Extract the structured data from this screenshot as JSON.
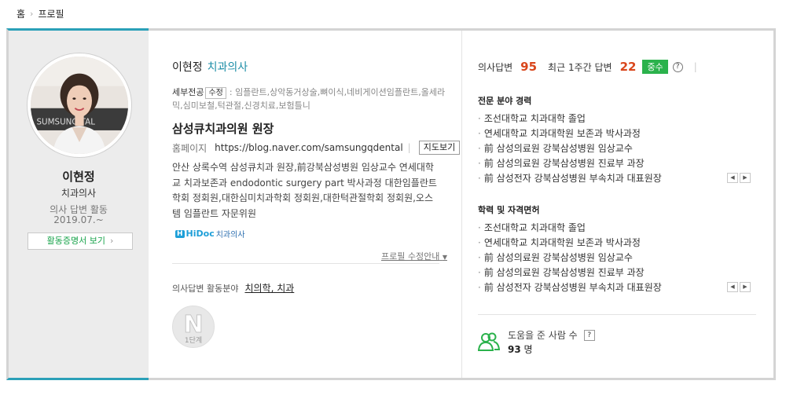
{
  "breadcrumb": {
    "home": "홈",
    "current": "프로필"
  },
  "profile": {
    "name": "이현정",
    "role": "치과의사",
    "activity_label": "의사 답변 활동",
    "activity_since": "2019.07.~",
    "cert_button": "활동증명서 보기",
    "avatar_text": "SUMSUNG      TAL"
  },
  "detail": {
    "name": "이현정",
    "role": "치과의사",
    "specialty_label": "세부전공",
    "specialty_edit": "수정",
    "specialty_text": ": 임플란트,상악동거상술,뼈이식,네비게이션임플란트,올세라믹,심미보철,턱관절,신경치료,보험틀니",
    "clinic": "삼성큐치과의원 원장",
    "homepage_label": "홈페이지",
    "homepage_url": "https://blog.naver.com/samsungqdental",
    "map_button": "지도보기",
    "bio": "안산 상록수역 삼성큐치과 원장,前강북삼성병원 임상교수 연세대학교 치과보존과 endodontic surgery part 박사과정 대한임플란트학회 정회원,대한심미치과학회 정회원,대한턱관절학회 정회원,오스템 임플란트 자문위원",
    "hidoc_mark": "H",
    "hidoc_brand": "HiDoc",
    "hidoc_sub": "치과의사",
    "edit_guide": "프로필 수정안내",
    "field_label": "의사답변 활동분야",
    "field_value": "치의학, 치과",
    "level_mark": "N",
    "level_text": "1단계"
  },
  "stats": {
    "answers_label": "의사답변",
    "answers_value": "95",
    "recent_label": "최근 1주간 답변",
    "recent_value": "22",
    "badge": "중수",
    "help": "?"
  },
  "career": {
    "title": "전문 분야 경력",
    "items": [
      "조선대학교 치과대학 졸업",
      "연세대학교 치과대학원 보존과 박사과정",
      "前 삼성의료원 강북삼성병원 임상교수",
      "前 삼성의료원 강북삼성병원 진료부 과장",
      "前 삼성전자 강북삼성병원 부속치과 대표원장"
    ]
  },
  "education": {
    "title": "학력 및 자격면허",
    "items": [
      "조선대학교 치과대학 졸업",
      "연세대학교 치과대학원 보존과 박사과정",
      "前 삼성의료원 강북삼성병원 임상교수",
      "前 삼성의료원 강북삼성병원 진료부 과장",
      "前 삼성전자 강북삼성병원 부속치과 대표원장"
    ]
  },
  "pager": {
    "prev": "◀",
    "next": "▶"
  },
  "helped": {
    "label": "도움을 준 사람 수",
    "help": "?",
    "count": "93",
    "unit": "명"
  },
  "colors": {
    "accent": "#2ba0b8",
    "green": "#2bb24c",
    "number": "#d9461c"
  }
}
